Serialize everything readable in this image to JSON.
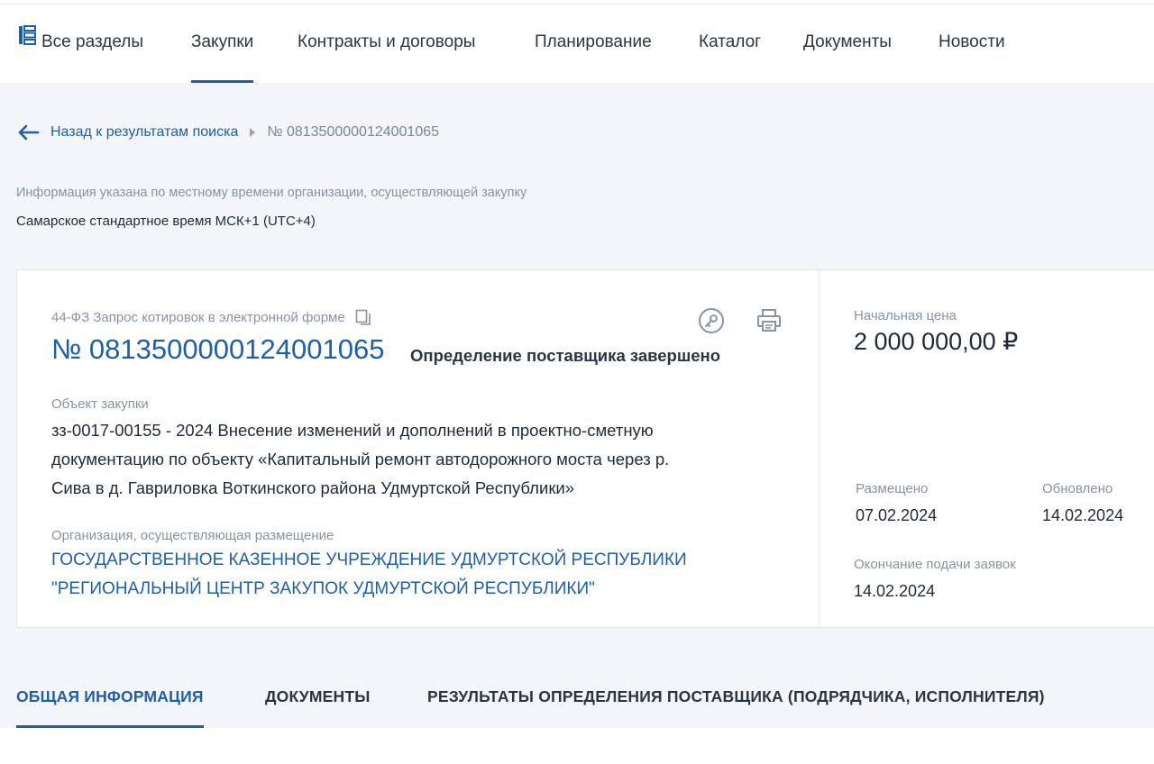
{
  "nav": {
    "all_sections": "Все разделы",
    "items": [
      "Закупки",
      "Контракты и договоры",
      "Планирование",
      "Каталог",
      "Документы",
      "Новости"
    ],
    "active": "Закупки"
  },
  "breadcrumb": {
    "back_label": "Назад к результатам поиска",
    "current": "№ 0813500000124001065"
  },
  "timezone": {
    "note": "Информация указана по местному времени организации, осуществляющей закупку",
    "value": "Самарское стандартное время МСК+1 (UTC+4)"
  },
  "purchase": {
    "law_type": "44-ФЗ Запрос котировок в электронной форме",
    "number": "№ 0813500000124001065",
    "status": "Определение поставщика завершено",
    "object_label": "Объект закупки",
    "object_lines": [
      "зз-0017-00155 - 2024 Внесение изменений и дополнений в проектно-сметную",
      "документацию по объекту «Капитальный ремонт автодорожного моста через р.",
      "Сива в д. Гавриловка Воткинского района Удмуртской Республики»"
    ],
    "org_label": "Организация, осуществляющая размещение",
    "org_lines": [
      "ГОСУДАРСТВЕННОЕ КАЗЕННОЕ УЧРЕЖДЕНИЕ УДМУРТСКОЙ РЕСПУБЛИКИ",
      "\"РЕГИОНАЛЬНЫЙ ЦЕНТР ЗАКУПОК УДМУРТСКОЙ РЕСПУБЛИКИ\""
    ],
    "price_label": "Начальная цена",
    "price": "2 000 000,00 ₽",
    "posted_label": "Размещено",
    "posted": "07.02.2024",
    "updated_label": "Обновлено",
    "updated": "14.02.2024",
    "deadline_label": "Окончание подачи заявок",
    "deadline": "14.02.2024"
  },
  "tabs": [
    "ОБЩАЯ ИНФОРМАЦИЯ",
    "ДОКУМЕНТЫ",
    "РЕЗУЛЬТАТЫ ОПРЕДЕЛЕНИЯ ПОСТАВЩИКА (ПОДРЯДЧИКА, ИСПОЛНИТЕЛЯ)"
  ],
  "active_tab": "ОБЩАЯ ИНФОРМАЦИЯ",
  "colors": {
    "accent": "#1e5fa8",
    "text": "#1f2a37",
    "muted": "#8893a1",
    "background": "#f3f5f8"
  },
  "icons": [
    "sections-grid-icon",
    "arrow-left-icon",
    "chevron-right-icon",
    "copy-icon",
    "key-icon",
    "printer-icon"
  ]
}
